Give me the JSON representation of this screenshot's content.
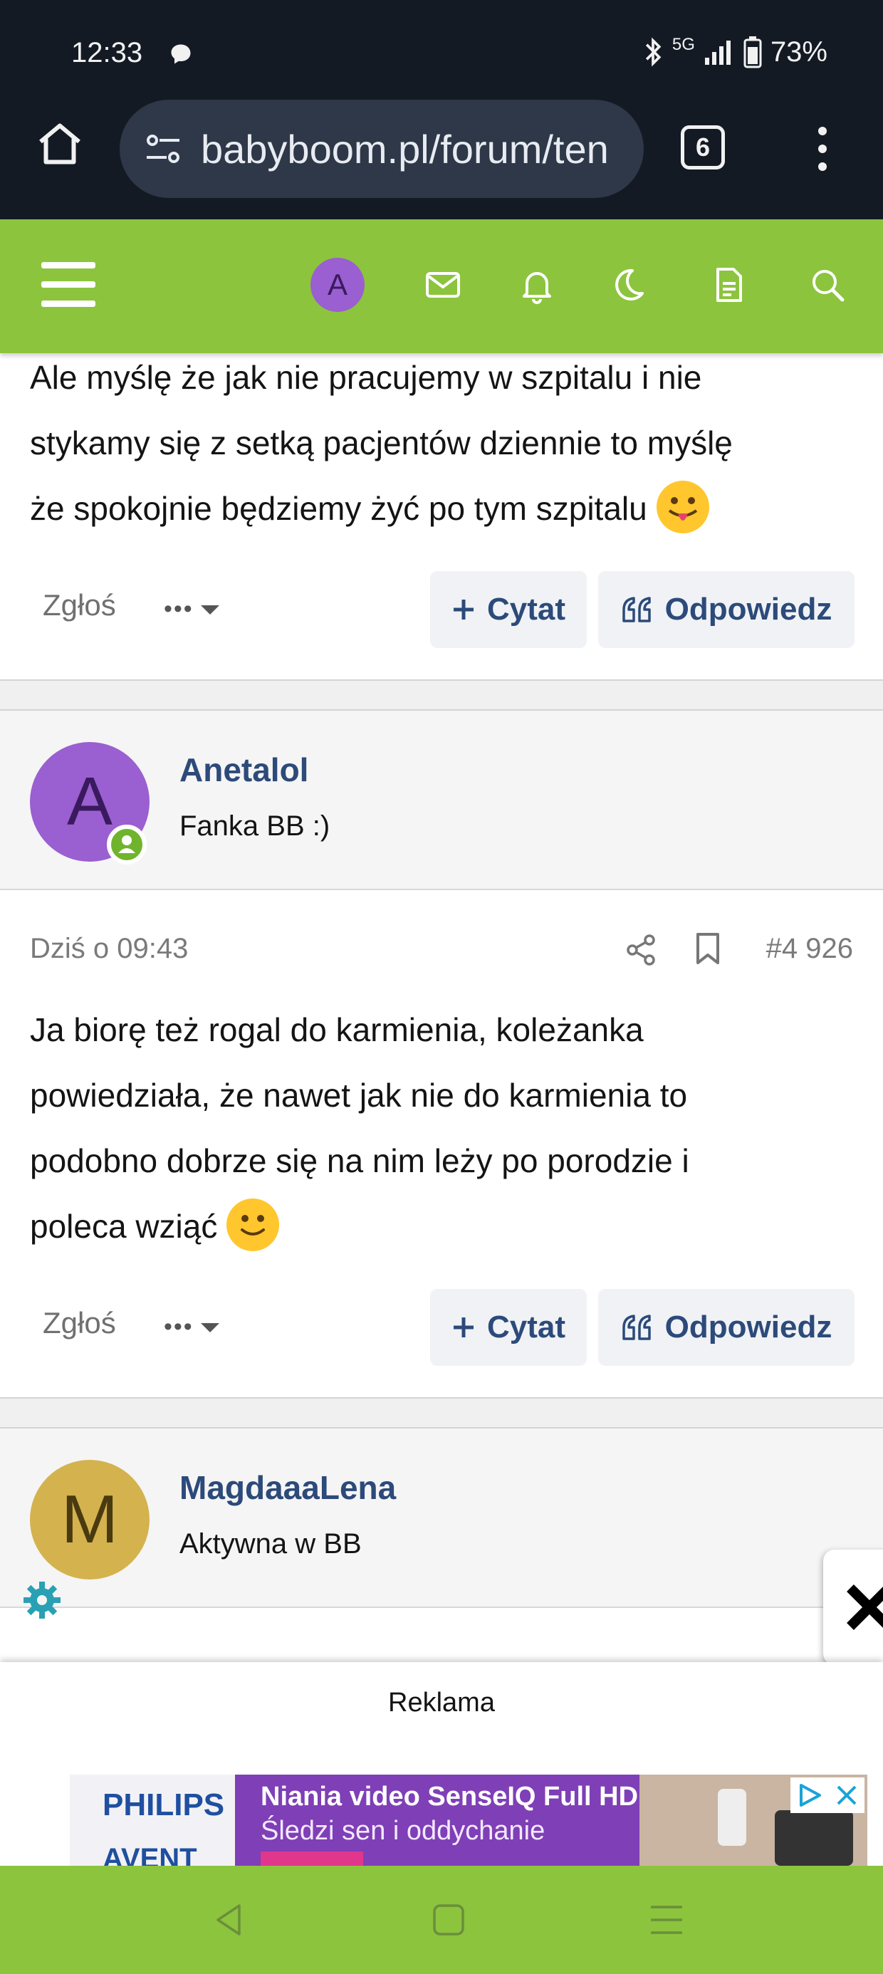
{
  "status_bar": {
    "time": "12:33",
    "network": "5G",
    "battery": "73%"
  },
  "browser": {
    "url": "babyboom.pl/forum/ten",
    "tab_count": "6"
  },
  "site_header": {
    "avatar_letter": "A",
    "icons": [
      "menu-icon",
      "avatar",
      "mail-icon",
      "bell-icon",
      "moon-icon",
      "document-icon",
      "search-icon"
    ],
    "accent_color": "#8cc43e"
  },
  "posts": [
    {
      "text_lines": [
        "Ale myślę że jak nie pracujemy w szpitalu i nie",
        "stykamy się z setką pacjentów dziennie to myślę",
        "że spokojnie będziemy żyć po tym szpitalu"
      ],
      "emoji": "tongue-out-emoji",
      "actions": {
        "report": "Zgłoś",
        "more": "•••",
        "quote": "Cytat",
        "reply": "Odpowiedz"
      }
    },
    {
      "author": {
        "avatar_letter": "A",
        "name": "Anetalol",
        "title": "Fanka BB :)",
        "avatar_color": "#9a5fd0"
      },
      "date": "Dziś o 09:43",
      "post_number": "#4 926",
      "text_lines": [
        "Ja biorę też rogal do karmienia, koleżanka",
        "powiedziała, że nawet jak nie do karmienia to",
        "podobno dobrze się na nim leży po porodzie i",
        "poleca wziąć"
      ],
      "emoji": "smile-emoji",
      "actions": {
        "report": "Zgłoś",
        "more": "•••",
        "quote": "Cytat",
        "reply": "Odpowiedz"
      }
    },
    {
      "author": {
        "avatar_letter": "M",
        "name": "MagdaaaLena",
        "title": "Aktywna w BB",
        "avatar_color": "#d4b24e"
      }
    }
  ],
  "ad": {
    "label": "Reklama",
    "brand": "PHILIPS",
    "brand_sub": "AVENT",
    "headline": "Niania video SenseIQ Full HD",
    "subline": "Śledzi sen i oddychanie"
  },
  "nav_bar": {
    "buttons": [
      "back-icon",
      "home-icon",
      "recents-icon"
    ]
  }
}
